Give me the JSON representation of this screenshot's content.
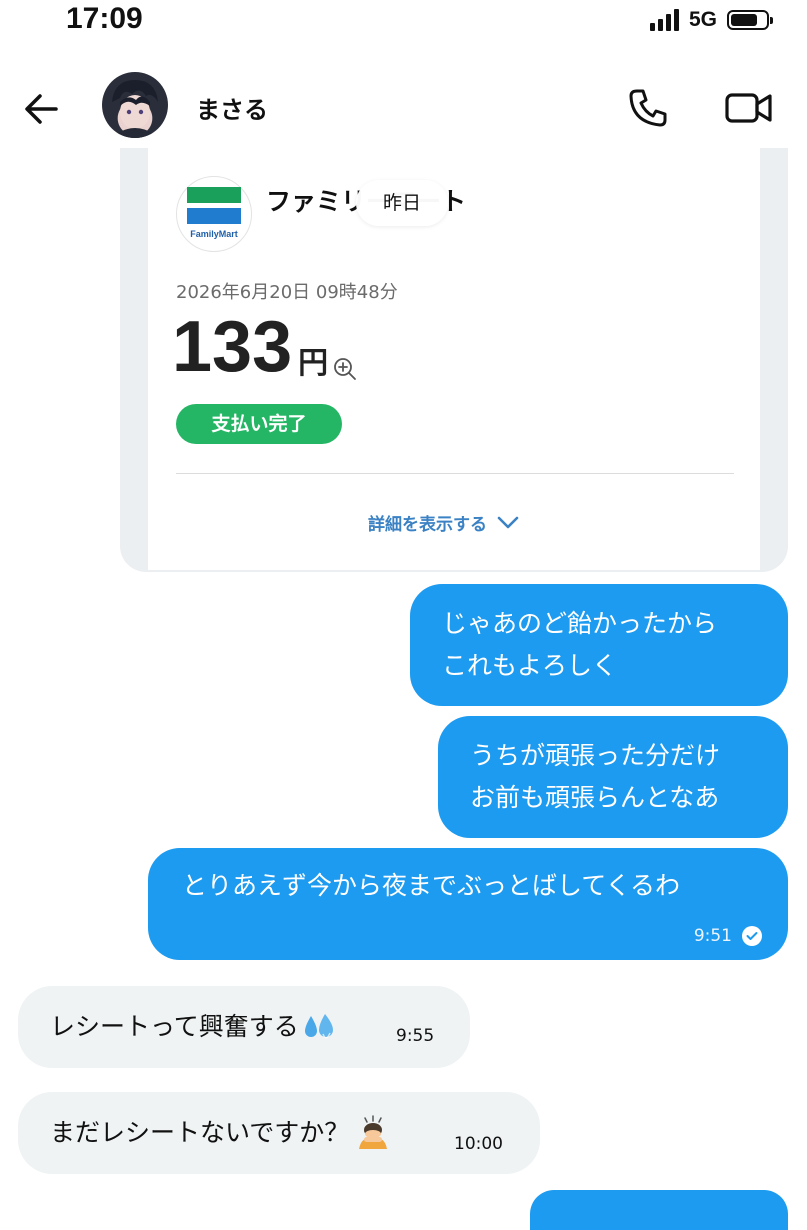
{
  "status_bar": {
    "time": "17:09",
    "network": "5G",
    "signal_bars": 4,
    "battery_level": 0.8
  },
  "header": {
    "contact_name": "まさる",
    "icons": [
      "back-arrow-icon",
      "phone-icon",
      "video-camera-icon"
    ]
  },
  "receipt": {
    "store_name": "ファミリーマート",
    "logo_text": "FamilyMart",
    "date_chip": "昨日",
    "datetime": "2026年6月20日 09時48分",
    "amount": "133",
    "unit": "円",
    "status": "支払い完了",
    "details_label": "詳細を表示する",
    "colors": {
      "logo_green": "#1aa05a",
      "logo_blue": "#1f7ccf",
      "paid_badge": "#25b665",
      "link": "#3b82c4"
    }
  },
  "messages": [
    {
      "direction": "out",
      "lines": [
        "じゃあのど飴かったから",
        "これもよろしく"
      ]
    },
    {
      "direction": "out",
      "lines": [
        "うちが頑張った分だけ",
        "お前も頑張らんとなあ"
      ]
    },
    {
      "direction": "out",
      "text": "とりあえず今から夜までぶっとばしてくるわ",
      "time": "9:51",
      "read": true
    },
    {
      "direction": "in",
      "text": "レシートって興奮する",
      "emoji": "sweat-droplets-icon",
      "time": "9:55"
    },
    {
      "direction": "in",
      "text": "まだレシートないですか？",
      "emoji": "bowing-person-icon",
      "time": "10:00"
    }
  ],
  "theme": {
    "outgoing_bubble": "#1d9bf0",
    "incoming_bubble": "#eff3f4"
  }
}
